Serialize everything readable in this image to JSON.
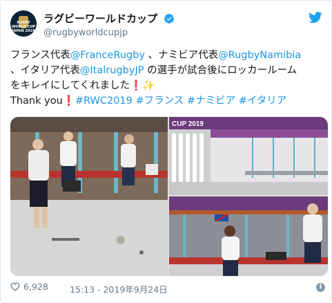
{
  "account": {
    "display_name": "ラグビーワールドカップ",
    "handle": "@rugbyworldcupjp",
    "avatar_text": "RUGBY WORLD CUP JAPAN 2019"
  },
  "tweet": {
    "line1_a": "フランス代表",
    "line1_link1": "@FranceRugby",
    "line1_b": " 、ナミビア代表",
    "line1_link2": "@RugbyNamibia",
    "line2_a": "、イタリア代表",
    "line2_link": "@ItalrugbyJP",
    "line2_b": " の選手が試合後にロッカールーム",
    "line3": "をキレイにしてくれました",
    "line3_emoji1": "❗",
    "line3_emoji2": "✨",
    "line4_a": "Thank you",
    "line4_emoji": "❗",
    "hashtag1": "#RWC2019",
    "hashtag2": "#フランス",
    "hashtag3": "#ナミビア",
    "hashtag4": "#イタリア"
  },
  "media": {
    "photo_tr_sign": "CUP 2019"
  },
  "footer": {
    "likes": "6,928",
    "timestamp": "15:13 - 2019年9月24日"
  },
  "colors": {
    "link": "#1b95e0",
    "text": "#14171a",
    "meta": "#657786",
    "verified": "#1da1f2"
  }
}
